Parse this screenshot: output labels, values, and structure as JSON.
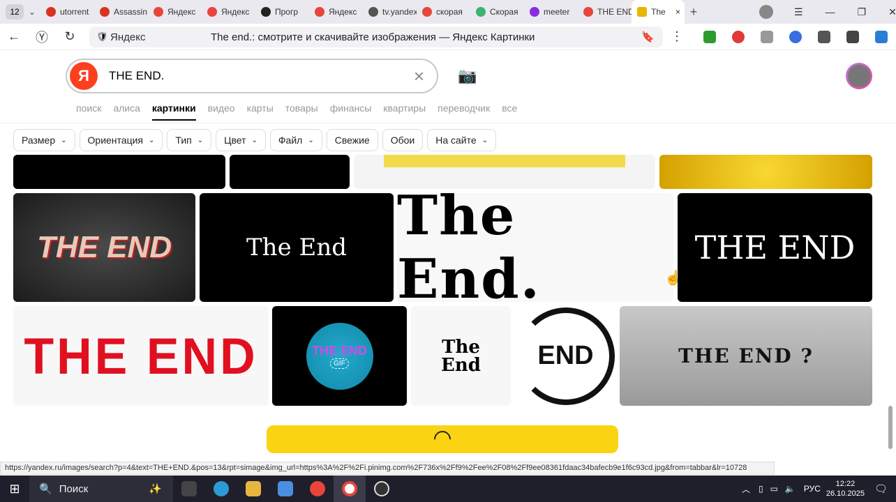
{
  "browser": {
    "tab_count": "12",
    "tabs": [
      {
        "label": "utorrent",
        "color": "#d9321f"
      },
      {
        "label": "Assassin",
        "color": "#d9321f"
      },
      {
        "label": "Яндекс",
        "color": "#e8453c"
      },
      {
        "label": "Яндекс",
        "color": "#e8453c"
      },
      {
        "label": "Прогр",
        "color": "#222"
      },
      {
        "label": "Яндекс",
        "color": "#e8453c"
      },
      {
        "label": "tv.yandex",
        "color": "#555"
      },
      {
        "label": "скорая",
        "color": "#e8453c"
      },
      {
        "label": "Скорая",
        "color": "#3cb371"
      },
      {
        "label": "meeter",
        "color": "#8a2be2"
      },
      {
        "label": "THE END",
        "color": "#e8453c"
      }
    ],
    "active_tab": {
      "label": "The",
      "close": "×"
    },
    "new_tab": "+",
    "site_label": "Яндекс",
    "page_title": "The end.: смотрите и скачивайте изображения — Яндекс Картинки"
  },
  "search": {
    "logo": "Я",
    "query": "THE END.",
    "clear": "×"
  },
  "services": [
    "поиск",
    "алиса",
    "картинки",
    "видео",
    "карты",
    "товары",
    "финансы",
    "квартиры",
    "переводчик",
    "все"
  ],
  "active_service": "картинки",
  "filters": [
    {
      "label": "Размер",
      "dropdown": true
    },
    {
      "label": "Ориентация",
      "dropdown": true
    },
    {
      "label": "Тип",
      "dropdown": true
    },
    {
      "label": "Цвет",
      "dropdown": true
    },
    {
      "label": "Файл",
      "dropdown": true
    },
    {
      "label": "Свежие",
      "dropdown": false
    },
    {
      "label": "Обои",
      "dropdown": false
    },
    {
      "label": "На сайте",
      "dropdown": true
    }
  ],
  "images": {
    "r2": [
      "THE END",
      "The End",
      "The End.",
      "THE END"
    ],
    "r3": [
      "THE END",
      "THE END",
      "The End",
      "END",
      "THE END ?"
    ],
    "gif_badge": "GIF"
  },
  "status_url": "https://yandex.ru/images/search?p=4&text=THE+END.&pos=13&rpt=simage&img_url=https%3A%2F%2Fi.pinimg.com%2F736x%2Ff9%2Fee%2F08%2Ff9ee08361fdaac34bafecb9e1f6c93cd.jpg&from=tabbar&lr=10728",
  "taskbar": {
    "search_label": "Поиск",
    "lang": "РУС",
    "time": "12:22",
    "date": "26.10.2025"
  }
}
